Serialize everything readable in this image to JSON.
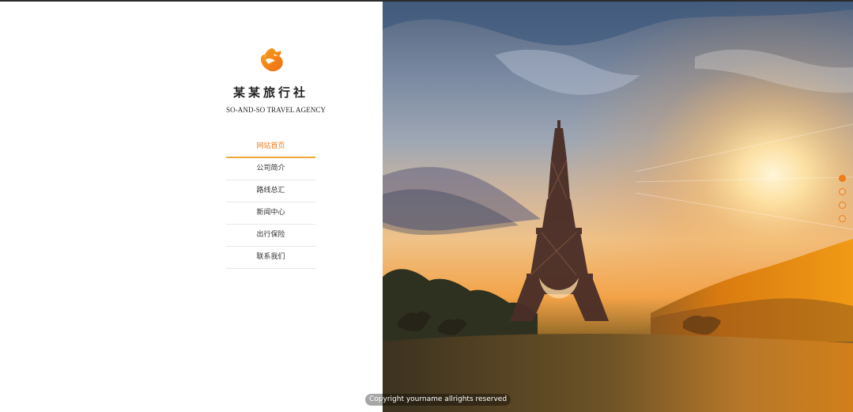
{
  "brand": {
    "name_cn": "某某旅行社",
    "name_en": "SO-AND-SO TRAVEL AGENCY",
    "logo_icon": "horse-head-icon",
    "accent_color": "#f07b17"
  },
  "nav": {
    "items": [
      {
        "label": "网站首页",
        "active": true
      },
      {
        "label": "公司简介",
        "active": false
      },
      {
        "label": "路线总汇",
        "active": false
      },
      {
        "label": "新闻中心",
        "active": false
      },
      {
        "label": "出行保险",
        "active": false
      },
      {
        "label": "联系我们",
        "active": false
      }
    ]
  },
  "carousel": {
    "slide_count": 4,
    "active_index": 0,
    "image_subject": "eiffel-tower-sunset"
  },
  "footer": {
    "copyright": "Copyright yourname allrights reserved"
  }
}
